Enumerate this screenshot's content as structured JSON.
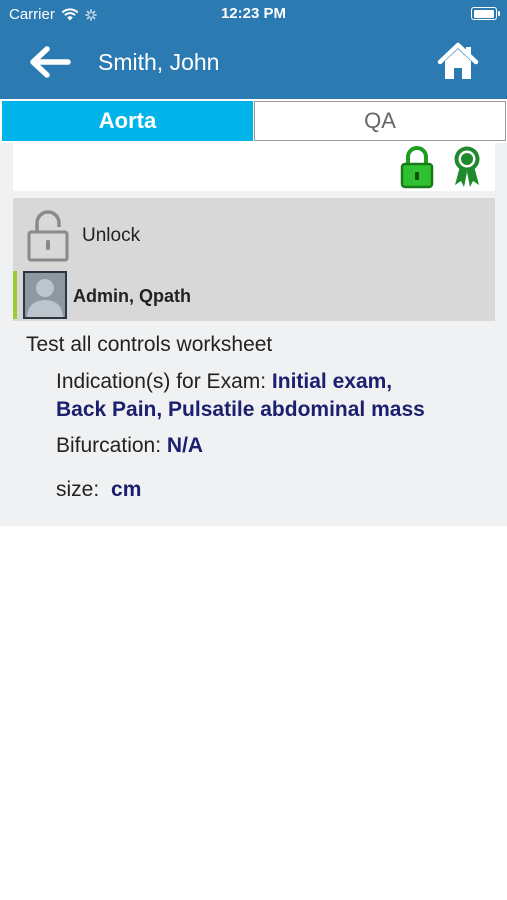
{
  "status_bar": {
    "carrier": "Carrier",
    "time": "12:23 PM",
    "battery_level": 1.0
  },
  "header": {
    "title": "Smith, John",
    "back_icon": "arrow-left-icon",
    "home_icon": "home-icon",
    "color": "#2b7ab1"
  },
  "tabs": [
    {
      "label": "Aorta",
      "active": true,
      "color": "#00b4ea"
    },
    {
      "label": "QA",
      "active": false
    }
  ],
  "status_icons": {
    "lock_icon": "locked-icon",
    "lock_color": "#1e9e1e",
    "certificate_icon": "award-ribbon-icon"
  },
  "lock_card": {
    "unlock_label": "Unlock",
    "user_name": "Admin, Qpath"
  },
  "worksheet": {
    "title": "Test all controls worksheet",
    "fields": [
      {
        "label": "Indication(s) for Exam:",
        "value": "Initial exam,",
        "value_line2": "Back Pain, Pulsatile abdominal mass"
      },
      {
        "label": "Bifurcation:",
        "value": "N/A"
      },
      {
        "label": "size:",
        "value": "cm"
      }
    ]
  }
}
